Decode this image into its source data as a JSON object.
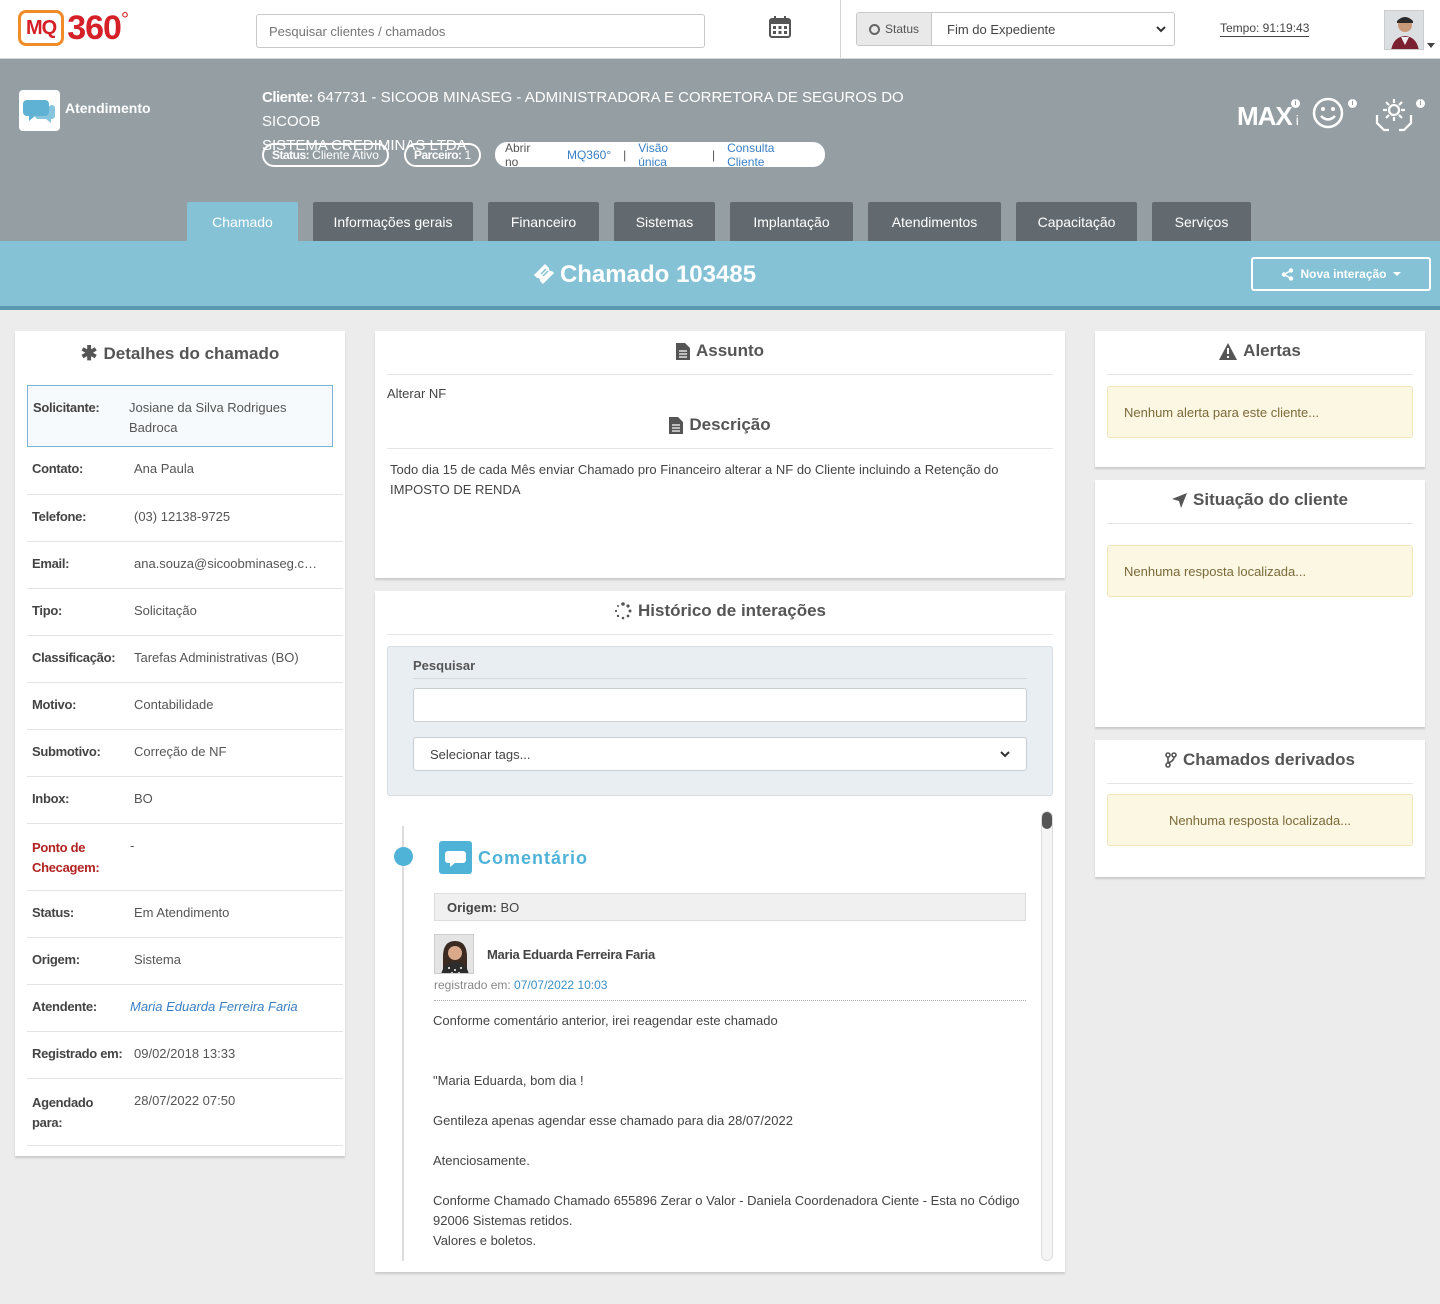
{
  "topbar": {
    "logo_mq": "MQ",
    "logo_num": "360",
    "logo_deg": "°",
    "search_placeholder": "Pesquisar clientes / chamados",
    "status_label": "Status",
    "status_value": "Fim do Expediente",
    "tempo": "Tempo: 91:19:43"
  },
  "header": {
    "module": "Atendimento",
    "client_label": "Cliente:",
    "client_line1": " 647731 - SICOOB MINASEG - ADMINISTRADORA E CORRETORA DE SEGUROS DO SICOOB",
    "client_line2": "SISTEMA CREDIMINAS LTDA",
    "status_key": "Status:",
    "status_val": "Cliente Ativo",
    "parceiro_key": "Parceiro:",
    "parceiro_val": "1",
    "open_in": "Abrir no",
    "links": [
      "MQ360°",
      "Visão única",
      "Consulta Cliente"
    ],
    "max": "MAX",
    "max_i": "i",
    "info": "i"
  },
  "tabs": [
    "Chamado",
    "Informações gerais",
    "Financeiro",
    "Sistemas",
    "Implantação",
    "Atendimentos",
    "Capacitação",
    "Serviços"
  ],
  "ticket": {
    "title": "Chamado 103485",
    "nova_interacao": "Nova interação"
  },
  "details": {
    "title": "Detalhes do chamado",
    "rows": [
      {
        "k": "Solicitante:",
        "v": "Josiane da Silva Rodrigues Badroca"
      },
      {
        "k": "Contato:",
        "v": "Ana Paula"
      },
      {
        "k": "Telefone:",
        "v": "(03) 12138-9725"
      },
      {
        "k": "Email:",
        "v": "ana.souza@sicoobminaseg.com.br"
      },
      {
        "k": "Tipo:",
        "v": "Solicitação"
      },
      {
        "k": "Classificação:",
        "v": "Tarefas Administrativas (BO)"
      },
      {
        "k": "Motivo:",
        "v": "Contabilidade"
      },
      {
        "k": "Submotivo:",
        "v": "Correção de NF"
      },
      {
        "k": "Inbox:",
        "v": "BO"
      },
      {
        "k": "Ponto de Checagem:",
        "v": "-"
      },
      {
        "k": "Status:",
        "v": "Em Atendimento"
      },
      {
        "k": "Origem:",
        "v": "Sistema"
      },
      {
        "k": "Atendente:",
        "v": "Maria Eduarda Ferreira Faria"
      },
      {
        "k": "Registrado em:",
        "v": "09/02/2018 13:33"
      },
      {
        "k": "Agendado para:",
        "v": "28/07/2022 07:50"
      }
    ]
  },
  "assunto": {
    "title": "Assunto",
    "text": "Alterar NF",
    "desc_title": "Descrição",
    "desc_text": "Todo dia 15 de cada Mês enviar Chamado pro Financeiro alterar a NF do Cliente incluindo a Retenção do IMPOSTO DE RENDA"
  },
  "historico": {
    "title": "Histórico de interações",
    "search_label": "Pesquisar",
    "search_value": "",
    "tags_placeholder": "Selecionar tags...",
    "comment_type": "Comentário",
    "origem_key": "Origem:",
    "origem_val": "BO",
    "author": "Maria Eduarda Ferreira Faria",
    "registered_label": "registrado em:",
    "registered_at": "07/07/2022 10:03",
    "lines": [
      "Conforme comentário anterior, irei reagendar este chamado",
      "\"Maria Eduarda, bom dia !",
      "Gentileza apenas agendar esse chamado para dia 28/07/2022",
      "Atenciosamente.",
      "Conforme Chamado Chamado 655896 Zerar o Valor - Daniela Coordenadora Ciente - Esta no Código 92006 Sistemas retidos.",
      "Valores e boletos."
    ]
  },
  "alertas": {
    "title": "Alertas",
    "text": "Nenhum alerta para este cliente..."
  },
  "situacao": {
    "title": "Situação do cliente",
    "text": "Nenhuma resposta localizada..."
  },
  "derivados": {
    "title": "Chamados derivados",
    "text": "Nenhuma resposta localizada..."
  },
  "colors": {
    "accent": "#85c2d6",
    "header": "#959fa3",
    "tab": "#636a6f",
    "link": "#3a7fc4",
    "required": "#b22222"
  }
}
